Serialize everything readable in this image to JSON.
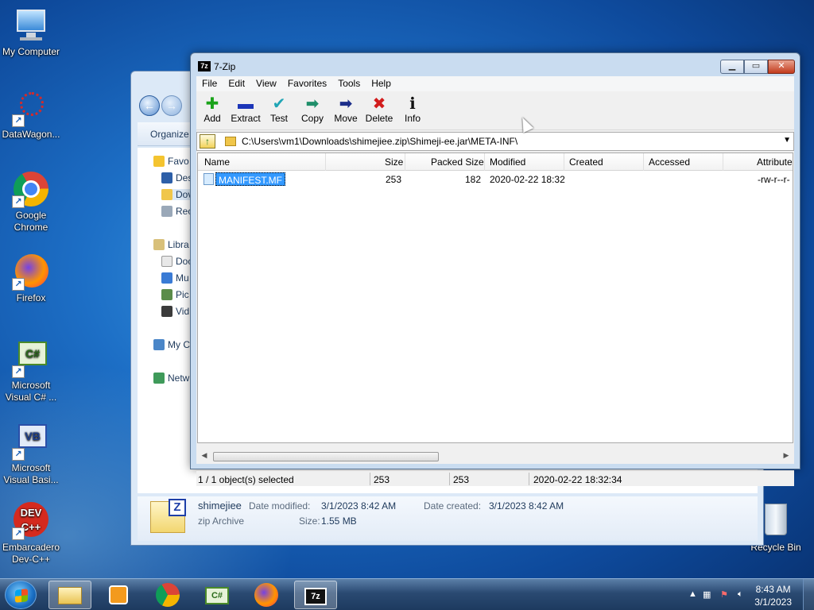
{
  "desktop": {
    "icons": [
      {
        "label": "My Computer"
      },
      {
        "label": "DataWagon..."
      },
      {
        "label": "Google Chrome"
      },
      {
        "label": "Firefox"
      },
      {
        "label": "Microsoft Visual C# ..."
      },
      {
        "label": "Microsoft Visual Basi..."
      },
      {
        "label": "Embarcadero Dev-C++"
      },
      {
        "label": "Recycle Bin"
      }
    ]
  },
  "explorer": {
    "organize_label": "Organize",
    "tree": [
      {
        "label": "Favo"
      },
      {
        "label": "Des"
      },
      {
        "label": "Dov"
      },
      {
        "label": "Rec"
      },
      {
        "label": "Libra"
      },
      {
        "label": "Doc"
      },
      {
        "label": "Mu"
      },
      {
        "label": "Pic"
      },
      {
        "label": "Vid"
      },
      {
        "label": "My C"
      },
      {
        "label": "Netw"
      }
    ],
    "details": {
      "name": "shimejiee",
      "type": "zip Archive",
      "modified_label": "Date modified:",
      "modified_value": "3/1/2023 8:42 AM",
      "created_label": "Date created:",
      "created_value": "3/1/2023 8:42 AM",
      "size_label": "Size:",
      "size_value": "1.55 MB"
    }
  },
  "zip": {
    "title": "7-Zip",
    "logo": "7z",
    "menu": [
      "File",
      "Edit",
      "View",
      "Favorites",
      "Tools",
      "Help"
    ],
    "toolbar": [
      {
        "label": "Add",
        "icon": "plus-icon",
        "glyph": "✚",
        "color": "#1aa31a"
      },
      {
        "label": "Extract",
        "icon": "minus-icon",
        "glyph": "▬",
        "color": "#1c35b8"
      },
      {
        "label": "Test",
        "icon": "check-icon",
        "glyph": "✔",
        "color": "#20a5b5"
      },
      {
        "label": "Copy",
        "icon": "copy-arrow-icon",
        "glyph": "➡",
        "color": "#1f8f6a"
      },
      {
        "label": "Move",
        "icon": "move-arrow-icon",
        "glyph": "➡",
        "color": "#1c2e8a"
      },
      {
        "label": "Delete",
        "icon": "delete-x-icon",
        "glyph": "✖",
        "color": "#d21c1c"
      },
      {
        "label": "Info",
        "icon": "info-icon",
        "glyph": "ℹ",
        "color": "#111111"
      }
    ],
    "path": "C:\\Users\\vm1\\Downloads\\shimejiee.zip\\Shimeji-ee.jar\\META-INF\\",
    "columns": [
      "Name",
      "Size",
      "Packed Size",
      "Modified",
      "Created",
      "Accessed",
      "Attribute"
    ],
    "rows": [
      {
        "name": "MANIFEST.MF",
        "size": "253",
        "packed": "182",
        "modified": "2020-02-22 18:32",
        "created": "",
        "accessed": "",
        "attr": "-rw-r--r-"
      }
    ],
    "status": {
      "selected": "1 / 1 object(s) selected",
      "size": "253",
      "packed": "253",
      "modified": "2020-02-22 18:32:34"
    }
  },
  "taskbar": {
    "clock_time": "8:43 AM",
    "clock_date": "3/1/2023"
  }
}
